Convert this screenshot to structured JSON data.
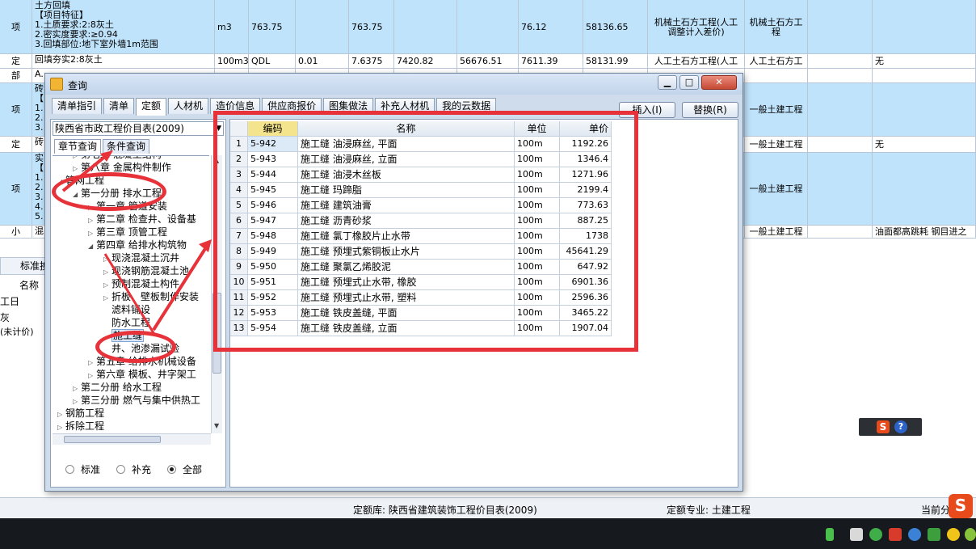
{
  "background": {
    "rows": [
      {
        "type": "项",
        "text": "土方回填\n【项目特征】\n1.土质要求:2:8灰土\n2.密实度要求:≥0.94\n3.回填部位:地下室外墙1m范围",
        "unit": "m3",
        "qty_expr": "763.75",
        "rate": "",
        "qty": "763.75",
        "c6": "",
        "c7": "",
        "c8": "76.12",
        "c9": "58136.65",
        "c10": "机械土石方工程(人工调整计入差价)",
        "c11": "机械土石方工程",
        "c12": "",
        "c13": ""
      },
      {
        "type": "定",
        "text": "回填夯实2:8灰土",
        "unit": "100m3",
        "qty_expr": "QDL",
        "rate": "0.01",
        "qty": "7.6375",
        "c6": "7420.82",
        "c7": "56676.51",
        "c8": "7611.39",
        "c9": "58131.99",
        "c10": "人工土石方工程(人工",
        "c11": "人工土石方工",
        "c12": "",
        "c13": "无"
      },
      {
        "type": "部",
        "text": "A.",
        "unit": "",
        "qty_expr": "",
        "rate": "",
        "qty": "",
        "c6": "",
        "c7": "",
        "c8": "",
        "c9": "",
        "c10": "",
        "c11": "",
        "c12": "",
        "c13": ""
      },
      {
        "type": "项",
        "text": "砖\n【\n1.\n2.\n3.",
        "unit": "",
        "qty_expr": "",
        "rate": "",
        "qty": "",
        "c6": "",
        "c7": "",
        "c8": "",
        "c9": "",
        "c10": "",
        "c11": "一般土建工程",
        "c12": "",
        "c13": ""
      },
      {
        "type": "定",
        "text": "砖",
        "unit": "",
        "qty_expr": "",
        "rate": "",
        "qty": "",
        "c6": "",
        "c7": "",
        "c8": "",
        "c9": "",
        "c10": "",
        "c11": "一般土建工程",
        "c12": "",
        "c13": "无"
      },
      {
        "type": "项",
        "text": "实\n【\n1.\n2.\n3.\n4.\n5.",
        "unit": "",
        "qty_expr": "",
        "rate": "",
        "qty": "",
        "c6": "",
        "c7": "",
        "c8": "",
        "c9": "",
        "c10": "",
        "c11": "一般土建工程",
        "c12": "",
        "c13": ""
      },
      {
        "type": "小",
        "text": "混",
        "unit": "",
        "qty_expr": "",
        "rate": "",
        "qty": "",
        "c6": "",
        "c7": "",
        "c8": "",
        "c9": "",
        "c10": "",
        "c11": "一般土建工程",
        "c12": "",
        "c13": "油面都高跳耗 钢目进之"
      }
    ],
    "lower_tab": "标准换",
    "lower_labels": [
      "名称",
      "工日",
      "灰",
      "(未计价)"
    ]
  },
  "status": {
    "quota_lib": "定额库: 陕西省建筑装饰工程价目表(2009)",
    "quota_major": "定额专业: 土建工程",
    "current": "当前分"
  },
  "dialog": {
    "title": "查询",
    "window_buttons": [
      "▁",
      "□",
      "✕"
    ],
    "tabs": [
      "清单指引",
      "清单",
      "定额",
      "人材机",
      "造价信息",
      "供应商报价",
      "图集做法",
      "补充人材机",
      "我的云数据"
    ],
    "active_tab": 2,
    "insert_btn": "插入(I)",
    "replace_btn": "替换(R)",
    "library": "陕西省市政工程价目表(2009)",
    "subtabs": [
      "章节查询",
      "条件查询"
    ],
    "tree": [
      {
        "label": "第七章 混凝土结构",
        "depth": 2,
        "twisty": "▷"
      },
      {
        "label": "第八章 金属构件制作",
        "depth": 2,
        "twisty": "▷"
      },
      {
        "label": "管网工程",
        "depth": 1,
        "twisty": "◢"
      },
      {
        "label": "第一分册 排水工程",
        "depth": 2,
        "twisty": "◢"
      },
      {
        "label": "第一章 管道安装",
        "depth": 3,
        "twisty": "▷"
      },
      {
        "label": "第二章 检查井、设备基",
        "depth": 3,
        "twisty": "▷"
      },
      {
        "label": "第三章 顶管工程",
        "depth": 3,
        "twisty": "▷"
      },
      {
        "label": "第四章 给排水构筑物",
        "depth": 3,
        "twisty": "◢"
      },
      {
        "label": "现浇混凝土沉井",
        "depth": 4,
        "twisty": "▷"
      },
      {
        "label": "现浇钢筋混凝土池",
        "depth": 4,
        "twisty": "▷"
      },
      {
        "label": "预制混凝土构件",
        "depth": 4,
        "twisty": "▷"
      },
      {
        "label": "折板、壁板制作安装",
        "depth": 4,
        "twisty": "▷"
      },
      {
        "label": "滤料铺设",
        "depth": 4,
        "twisty": ""
      },
      {
        "label": "防水工程",
        "depth": 4,
        "twisty": ""
      },
      {
        "label": "施工缝",
        "depth": 4,
        "twisty": "",
        "selected": true
      },
      {
        "label": "井、池渗漏试验",
        "depth": 4,
        "twisty": ""
      },
      {
        "label": "第五章 给排水机械设备",
        "depth": 3,
        "twisty": "▷"
      },
      {
        "label": "第六章 模板、井字架工",
        "depth": 3,
        "twisty": "▷"
      },
      {
        "label": "第二分册 给水工程",
        "depth": 2,
        "twisty": "▷"
      },
      {
        "label": "第三分册 燃气与集中供热工",
        "depth": 2,
        "twisty": "▷"
      },
      {
        "label": "钢筋工程",
        "depth": 1,
        "twisty": "▷"
      },
      {
        "label": "拆除工程",
        "depth": 1,
        "twisty": "▷"
      }
    ],
    "radios": [
      {
        "label": "标准",
        "checked": false
      },
      {
        "label": "补充",
        "checked": false
      },
      {
        "label": "全部",
        "checked": true
      }
    ],
    "grid": {
      "headers": [
        "",
        "编码",
        "名称",
        "单位",
        "单价"
      ],
      "rows": [
        {
          "idx": "1",
          "code": "5-942",
          "name": "施工缝 油浸麻丝, 平面",
          "unit": "100m",
          "price": "1192.26"
        },
        {
          "idx": "2",
          "code": "5-943",
          "name": "施工缝 油浸麻丝, 立面",
          "unit": "100m",
          "price": "1346.4"
        },
        {
          "idx": "3",
          "code": "5-944",
          "name": "施工缝 油浸木丝板",
          "unit": "100m",
          "price": "1271.96"
        },
        {
          "idx": "4",
          "code": "5-945",
          "name": "施工缝 玛蹄脂",
          "unit": "100m",
          "price": "2199.4"
        },
        {
          "idx": "5",
          "code": "5-946",
          "name": "施工缝 建筑油膏",
          "unit": "100m",
          "price": "773.63"
        },
        {
          "idx": "6",
          "code": "5-947",
          "name": "施工缝 沥青砂浆",
          "unit": "100m",
          "price": "887.25"
        },
        {
          "idx": "7",
          "code": "5-948",
          "name": "施工缝 氯丁橡胶片止水带",
          "unit": "100m",
          "price": "1738"
        },
        {
          "idx": "8",
          "code": "5-949",
          "name": "施工缝 预埋式紫铜板止水片",
          "unit": "100m",
          "price": "45641.29"
        },
        {
          "idx": "9",
          "code": "5-950",
          "name": "施工缝 聚氯乙烯胶泥",
          "unit": "100m",
          "price": "647.92"
        },
        {
          "idx": "10",
          "code": "5-951",
          "name": "施工缝 预埋式止水带, 橡胶",
          "unit": "100m",
          "price": "6901.36"
        },
        {
          "idx": "11",
          "code": "5-952",
          "name": "施工缝 预埋式止水带, 塑料",
          "unit": "100m",
          "price": "2596.36"
        },
        {
          "idx": "12",
          "code": "5-953",
          "name": "施工缝 铁皮盖缝, 平面",
          "unit": "100m",
          "price": "3465.22"
        },
        {
          "idx": "13",
          "code": "5-954",
          "name": "施工缝 铁皮盖缝, 立面",
          "unit": "100m",
          "price": "1907.04"
        }
      ]
    }
  },
  "colors": {
    "annotation_red": "#e8323a",
    "row_blue": "#bfe3fb"
  }
}
